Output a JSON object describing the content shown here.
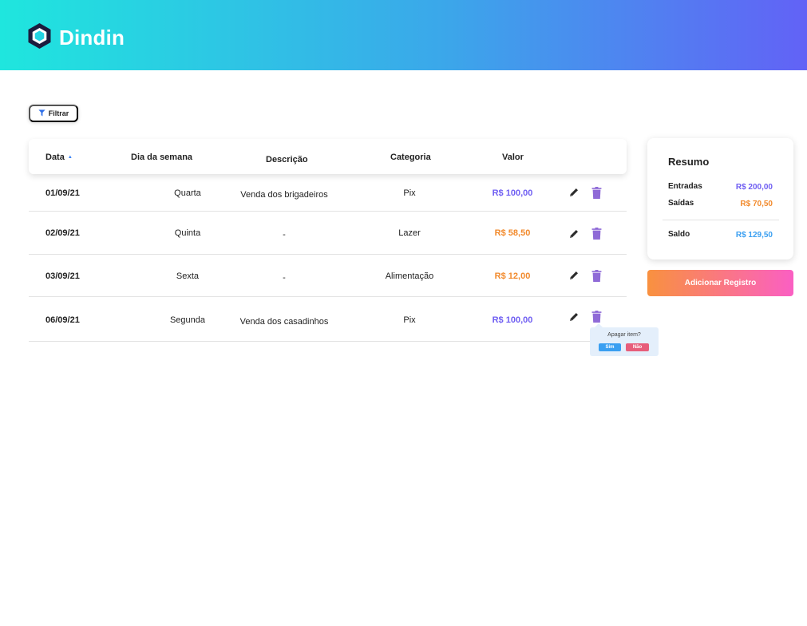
{
  "app": {
    "name": "Dindin"
  },
  "toolbar": {
    "filter_label": "Filtrar"
  },
  "table": {
    "headers": {
      "date": "Data",
      "weekday": "Dia da semana",
      "description": "Descrição",
      "category": "Categoria",
      "value": "Valor"
    },
    "sort": {
      "column": "date",
      "direction": "ascending"
    },
    "rows": [
      {
        "date": "01/09/21",
        "weekday": "Quarta",
        "description": "Venda dos brigadeiros",
        "category": "Pix",
        "value": "R$ 100,00",
        "type": "entrada"
      },
      {
        "date": "02/09/21",
        "weekday": "Quinta",
        "description": "-",
        "category": "Lazer",
        "value": "R$ 58,50",
        "type": "saida"
      },
      {
        "date": "03/09/21",
        "weekday": "Sexta",
        "description": "-",
        "category": "Alimentação",
        "value": "R$ 12,00",
        "type": "saida"
      },
      {
        "date": "06/09/21",
        "weekday": "Segunda",
        "description": "Venda dos casadinhos",
        "category": "Pix",
        "value": "R$ 100,00",
        "type": "entrada"
      }
    ]
  },
  "delete_confirm": {
    "question": "Apagar item?",
    "yes": "Sim",
    "no": "Não"
  },
  "summary": {
    "title": "Resumo",
    "income_label": "Entradas",
    "income_value": "R$ 200,00",
    "expense_label": "Saídas",
    "expense_value": "R$ 70,50",
    "balance_label": "Saldo",
    "balance_value": "R$ 129,50"
  },
  "add_button": "Adicionar Registro",
  "icons": {
    "logo": "hexagon-logo-icon",
    "filter": "filter-funnel-icon",
    "sort": "sort-ascending-icon",
    "edit": "pencil-icon",
    "delete": "trash-icon"
  },
  "colors": {
    "income": "#6f5ef2",
    "expense": "#f28a2c",
    "balance": "#3a9ff1",
    "trash": "#8f6ad7",
    "header_gradient": [
      "#1fe6de",
      "#6262f6"
    ],
    "add_button_gradient": [
      "#f9913f",
      "#fa5fc3"
    ]
  }
}
